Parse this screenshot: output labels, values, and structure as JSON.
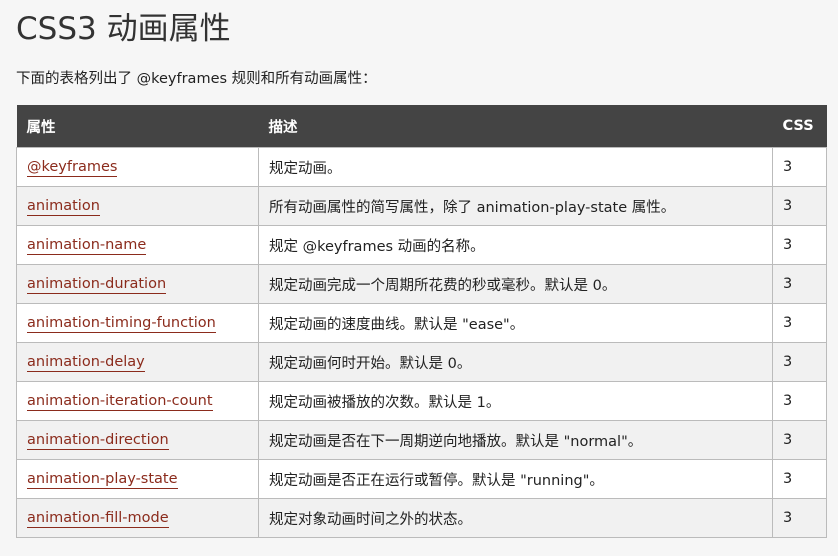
{
  "page": {
    "title": "CSS3 动画属性",
    "intro": "下面的表格列出了 @keyframes 规则和所有动画属性："
  },
  "table": {
    "headers": [
      "属性",
      "描述",
      "CSS"
    ],
    "rows": [
      {
        "property": "@keyframes",
        "description": "规定动画。",
        "css": "3"
      },
      {
        "property": "animation",
        "description": "所有动画属性的简写属性，除了 animation-play-state 属性。",
        "css": "3"
      },
      {
        "property": "animation-name",
        "description": "规定 @keyframes 动画的名称。",
        "css": "3"
      },
      {
        "property": "animation-duration",
        "description": "规定动画完成一个周期所花费的秒或毫秒。默认是 0。",
        "css": "3"
      },
      {
        "property": "animation-timing-function",
        "description": "规定动画的速度曲线。默认是 \"ease\"。",
        "css": "3"
      },
      {
        "property": "animation-delay",
        "description": "规定动画何时开始。默认是 0。",
        "css": "3"
      },
      {
        "property": "animation-iteration-count",
        "description": "规定动画被播放的次数。默认是 1。",
        "css": "3"
      },
      {
        "property": "animation-direction",
        "description": "规定动画是否在下一周期逆向地播放。默认是 \"normal\"。",
        "css": "3"
      },
      {
        "property": "animation-play-state",
        "description": "规定动画是否正在运行或暂停。默认是 \"running\"。",
        "css": "3"
      },
      {
        "property": "animation-fill-mode",
        "description": "规定对象动画时间之外的状态。",
        "css": "3"
      }
    ]
  },
  "colors": {
    "header_bg": "#444444",
    "link": "#8b2b1c",
    "page_bg": "#f6f6f6"
  }
}
